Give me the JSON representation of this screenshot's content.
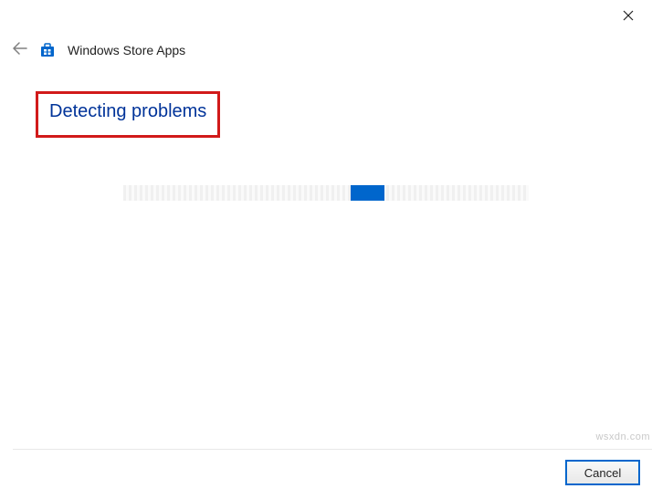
{
  "header": {
    "title": "Windows Store Apps",
    "back_icon": "back-arrow",
    "app_icon": "store-icon"
  },
  "close": {
    "icon": "close-icon"
  },
  "main": {
    "status_heading": "Detecting problems"
  },
  "footer": {
    "cancel_label": "Cancel"
  },
  "watermark": "wsxdn.com"
}
